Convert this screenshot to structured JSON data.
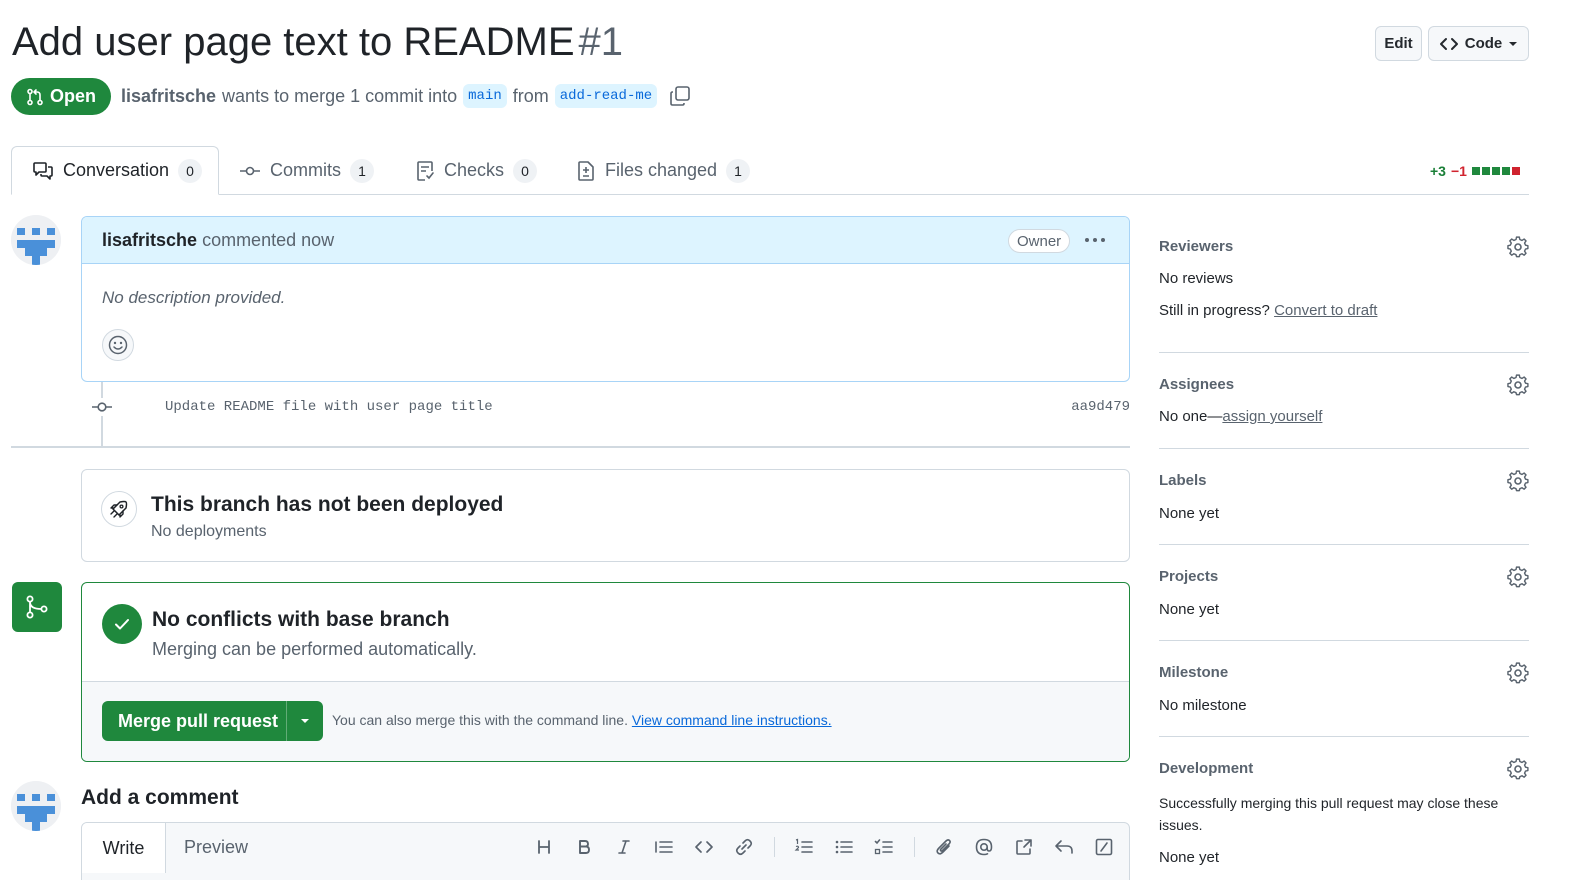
{
  "pr": {
    "title": "Add user page text to README",
    "number": "#1",
    "state": "Open",
    "author": "lisafritsche",
    "merge_text": "wants to merge 1 commit into",
    "base_branch": "main",
    "from_text": "from",
    "head_branch": "add-read-me"
  },
  "header": {
    "edit_label": "Edit",
    "code_label": "Code"
  },
  "tabs": [
    {
      "label": "Conversation",
      "count": "0"
    },
    {
      "label": "Commits",
      "count": "1"
    },
    {
      "label": "Checks",
      "count": "0"
    },
    {
      "label": "Files changed",
      "count": "1"
    }
  ],
  "diffstat": {
    "additions": "+3",
    "deletions": "−1",
    "colors": [
      "#1f883d",
      "#1f883d",
      "#1f883d",
      "#1f883d",
      "#cf222e"
    ]
  },
  "comment": {
    "author": "lisafritsche",
    "action": "commented now",
    "badge": "Owner",
    "body": "No description provided."
  },
  "commit": {
    "message": "Update README file with user page title",
    "sha": "aa9d479"
  },
  "deployment": {
    "title": "This branch has not been deployed",
    "subtitle": "No deployments"
  },
  "merge": {
    "title": "No conflicts with base branch",
    "subtitle": "Merging can be performed automatically.",
    "button_label": "Merge pull request",
    "note": "You can also merge this with the command line.",
    "link_label": "View command line instructions."
  },
  "add_comment": {
    "title": "Add a comment",
    "write_tab": "Write",
    "preview_tab": "Preview"
  },
  "sidebar": {
    "reviewers": {
      "title": "Reviewers",
      "value": "No reviews",
      "draft_prompt": "Still in progress?",
      "draft_link": "Convert to draft"
    },
    "assignees": {
      "title": "Assignees",
      "value": "No one—",
      "assign_link": "assign yourself"
    },
    "labels": {
      "title": "Labels",
      "value": "None yet"
    },
    "projects": {
      "title": "Projects",
      "value": "None yet"
    },
    "milestone": {
      "title": "Milestone",
      "value": "No milestone"
    },
    "development": {
      "title": "Development",
      "description": "Successfully merging this pull request may close these issues.",
      "value": "None yet"
    }
  },
  "colors": {
    "accent_green": "#1f883d",
    "link_blue": "#0969da",
    "comment_header_bg": "#ddf4ff"
  }
}
